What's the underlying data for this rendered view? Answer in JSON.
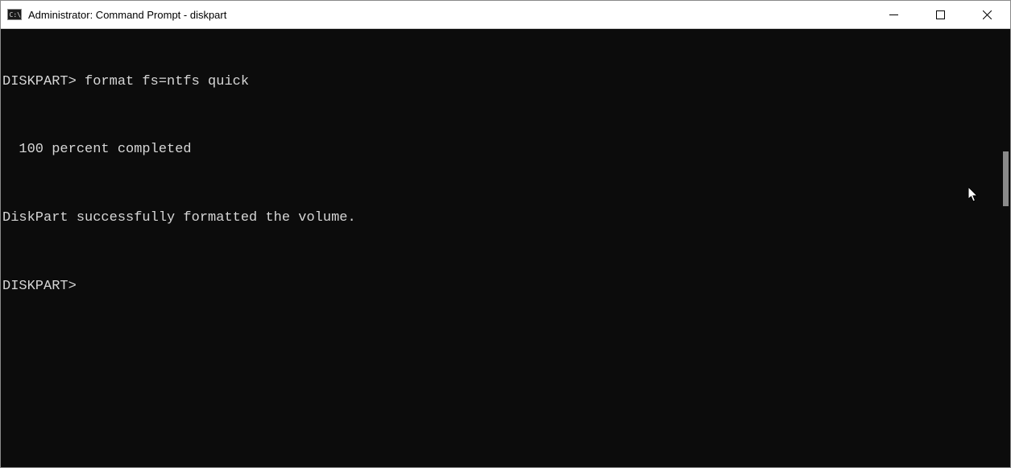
{
  "window": {
    "title": "Administrator: Command Prompt - diskpart"
  },
  "terminal": {
    "lines": [
      "DISKPART> format fs=ntfs quick",
      "  100 percent completed",
      "DiskPart successfully formatted the volume.",
      "DISKPART>"
    ]
  }
}
